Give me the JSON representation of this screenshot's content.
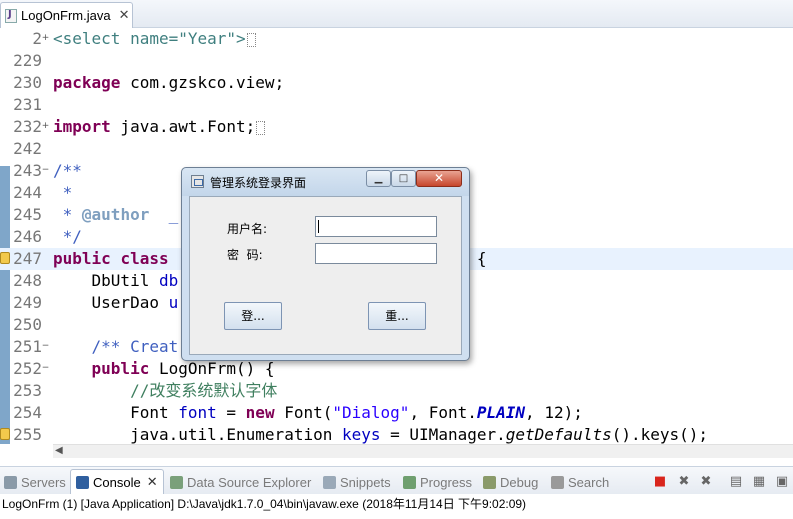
{
  "editor": {
    "tab_label": "LogOnFrm.java",
    "tab_close": "✕",
    "lines": [
      {
        "num": "2",
        "fold": "+",
        "tokens": [
          {
            "t": "<select name=\"Year\">",
            "c": "dim"
          }
        ],
        "box": true
      },
      {
        "num": "229",
        "tokens": []
      },
      {
        "num": "230",
        "tokens": [
          {
            "t": "package",
            "c": "kw"
          },
          {
            "t": " com.gzskco.view;",
            "c": "plain"
          }
        ]
      },
      {
        "num": "231",
        "tokens": []
      },
      {
        "num": "232",
        "fold": "+",
        "tokens": [
          {
            "t": "import",
            "c": "kw"
          },
          {
            "t": " java.awt.Font;",
            "c": "plain"
          }
        ],
        "box": true
      },
      {
        "num": "242",
        "tokens": []
      },
      {
        "num": "243",
        "fold": "−",
        "tokens": [
          {
            "t": "/**",
            "c": "jdoc"
          }
        ]
      },
      {
        "num": "244",
        "tokens": [
          {
            "t": " *",
            "c": "jdoc"
          }
        ]
      },
      {
        "num": "245",
        "tokens": [
          {
            "t": " * ",
            "c": "jdoc"
          },
          {
            "t": "@author",
            "c": "tag"
          },
          {
            "t": "  _",
            "c": "jdoc"
          }
        ]
      },
      {
        "num": "246",
        "tokens": [
          {
            "t": " */",
            "c": "jdoc"
          }
        ]
      },
      {
        "num": "247",
        "warn": true,
        "hl": true,
        "tokens": [
          {
            "t": "public",
            "c": "kw"
          },
          {
            "t": " ",
            "c": "plain"
          },
          {
            "t": "class",
            "c": "kw"
          },
          {
            "t": "                         JFrame {",
            "c": "plain"
          }
        ]
      },
      {
        "num": "248",
        "tokens": [
          {
            "t": "    DbUtil ",
            "c": "plain"
          },
          {
            "t": "db",
            "c": "fld"
          }
        ]
      },
      {
        "num": "249",
        "tokens": [
          {
            "t": "    UserDao ",
            "c": "plain"
          },
          {
            "t": "u",
            "c": "fld"
          }
        ]
      },
      {
        "num": "250",
        "tokens": []
      },
      {
        "num": "251",
        "fold": "−",
        "tokens": [
          {
            "t": "    /** Creat",
            "c": "jdoc"
          }
        ]
      },
      {
        "num": "252",
        "fold": "−",
        "tokens": [
          {
            "t": "    ",
            "c": "plain"
          },
          {
            "t": "public",
            "c": "kw"
          },
          {
            "t": " LogOnFrm() {",
            "c": "plain"
          }
        ]
      },
      {
        "num": "253",
        "tokens": [
          {
            "t": "        //改变系统默认字体",
            "c": "cmt"
          }
        ]
      },
      {
        "num": "254",
        "tokens": [
          {
            "t": "        Font ",
            "c": "plain"
          },
          {
            "t": "font",
            "c": "fld"
          },
          {
            "t": " = ",
            "c": "plain"
          },
          {
            "t": "new",
            "c": "kw"
          },
          {
            "t": " Font(",
            "c": "plain"
          },
          {
            "t": "\"Dialog\"",
            "c": "str"
          },
          {
            "t": ", Font.",
            "c": "plain"
          },
          {
            "t": "PLAIN",
            "c": "cst"
          },
          {
            "t": ", 12);",
            "c": "plain"
          }
        ]
      },
      {
        "num": "255",
        "warn": true,
        "tokens": [
          {
            "t": "        java.util.Enumeration ",
            "c": "plain"
          },
          {
            "t": "keys",
            "c": "fld"
          },
          {
            "t": " = UIManager.",
            "c": "plain"
          },
          {
            "t": "getDefaults",
            "c": "stm"
          },
          {
            "t": "().keys();",
            "c": "plain"
          }
        ]
      }
    ]
  },
  "dialog": {
    "title": "管理系统登录界面",
    "min_glyph": "▁",
    "max_glyph": "□",
    "close_glyph": "✕",
    "username_label": "用户名:",
    "password_label": "密  码:",
    "username_value": "",
    "password_value": "",
    "login_button": "登...",
    "reset_button": "重..."
  },
  "views": {
    "tabs": [
      {
        "label": "Servers",
        "icon": "servers-icon",
        "color": "#8a9aa8"
      },
      {
        "label": "Console",
        "icon": "console-icon",
        "color": "#2f5f9f",
        "active": true
      },
      {
        "label": "Data Source Explorer",
        "icon": "database-icon",
        "color": "#7aa07a"
      },
      {
        "label": "Snippets",
        "icon": "snippets-icon",
        "color": "#9aa9b8"
      },
      {
        "label": "Progress",
        "icon": "progress-icon",
        "color": "#6f9f6f"
      },
      {
        "label": "Debug",
        "icon": "debug-icon",
        "color": "#8a9a6a"
      },
      {
        "label": "Search",
        "icon": "search-icon",
        "color": "#9a9a9a"
      }
    ],
    "console_close": "✕"
  },
  "console": {
    "status": "LogOnFrm (1) [Java Application] D:\\Java\\jdk1.7.0_04\\bin\\javaw.exe (2018年11月14日 下午9:02:09)"
  },
  "colors": {
    "keyword": "#7f0055",
    "string": "#2a00ff",
    "comment": "#3f7f5f",
    "javadoc": "#3f5fbf",
    "field": "#0000c0",
    "terminate": "#d9251c"
  }
}
